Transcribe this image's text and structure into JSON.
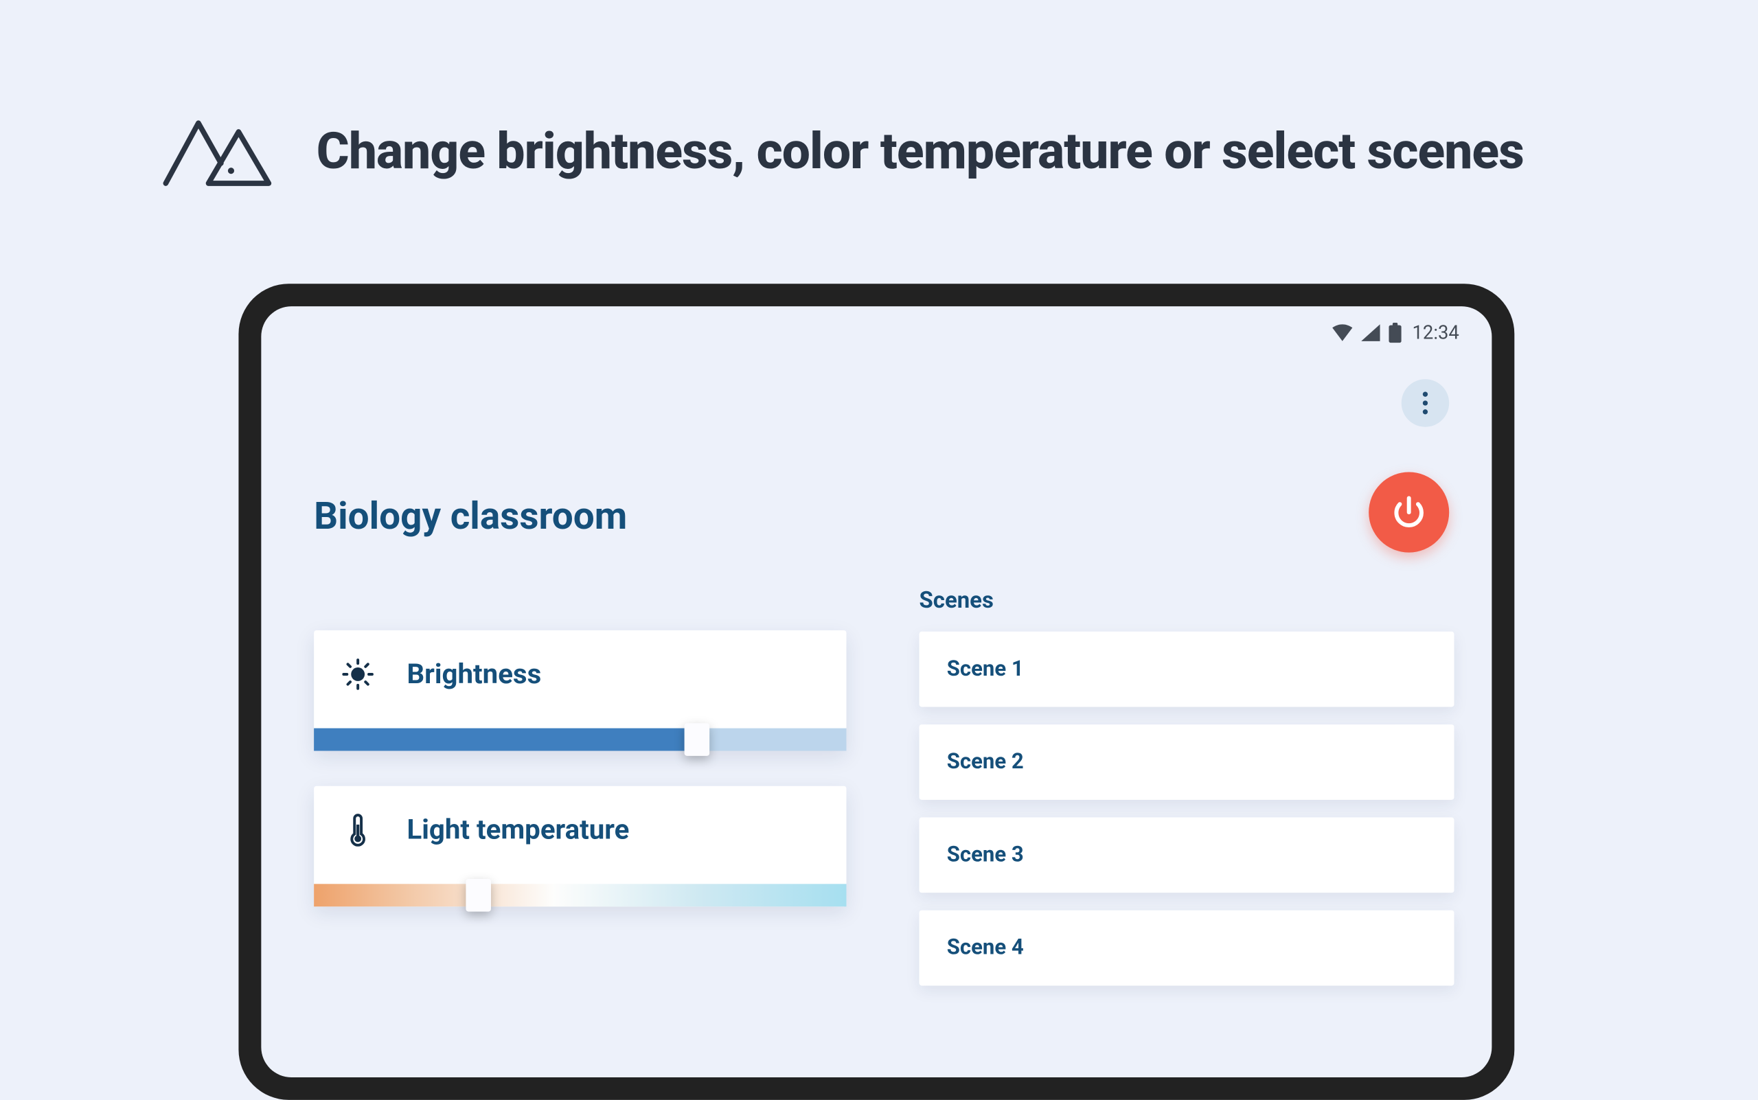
{
  "hero": {
    "title": "Change brightness, color temperature or select scenes"
  },
  "status_bar": {
    "time": "12:34"
  },
  "room": {
    "title": "Biology classroom"
  },
  "sliders": {
    "brightness": {
      "label": "Brightness",
      "value_pct": 72
    },
    "temperature": {
      "label": "Light temperature",
      "value_pct": 31
    }
  },
  "scenes": {
    "heading": "Scenes",
    "items": [
      "Scene 1",
      "Scene 2",
      "Scene 3",
      "Scene 4"
    ]
  },
  "colors": {
    "accent_navy": "#154f7a",
    "power_button": "#f25b47",
    "slider_blue": "#3f7fbf",
    "page_bg": "#edf1fa"
  }
}
